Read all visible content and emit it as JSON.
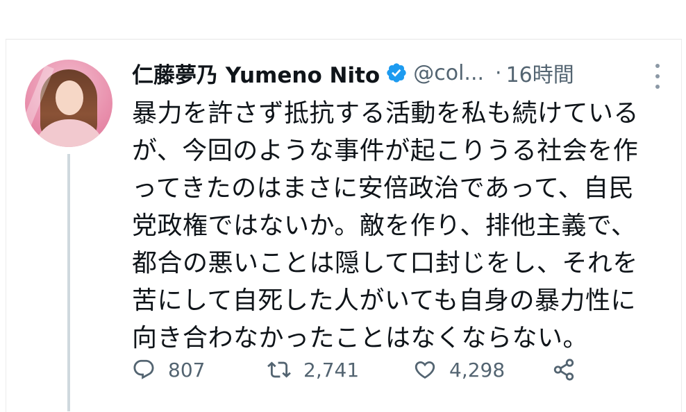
{
  "tweet": {
    "author": {
      "display_name": "仁藤夢乃 Yumeno Nito",
      "handle": "@col...",
      "verified": true
    },
    "separator": "·",
    "time": "16時間",
    "text_lines": [
      "暴力を許さず抵抗する活動を私も続けている",
      "が、今回のような事件が起こりうる社会を作",
      "ってきたのはまさに安倍政治であって、自民",
      "党政権ではないか。敵を作り、排他主義で、",
      "都合の悪いことは隠して口封じをし、それを",
      "苦にして自死した人がいても自身の暴力性に",
      "向き合わなかったことはなくならない。"
    ],
    "stats": {
      "replies": "807",
      "retweets": "2,741",
      "likes": "4,298"
    }
  },
  "icons": {
    "verified": "verified-badge-icon",
    "more": "more-vertical-icon",
    "reply": "reply-icon",
    "retweet": "retweet-icon",
    "like": "heart-icon",
    "share": "share-icon"
  },
  "colors": {
    "verified_blue": "#1d9bf0",
    "secondary_text": "#536471",
    "thread_line": "#cfd9de"
  }
}
